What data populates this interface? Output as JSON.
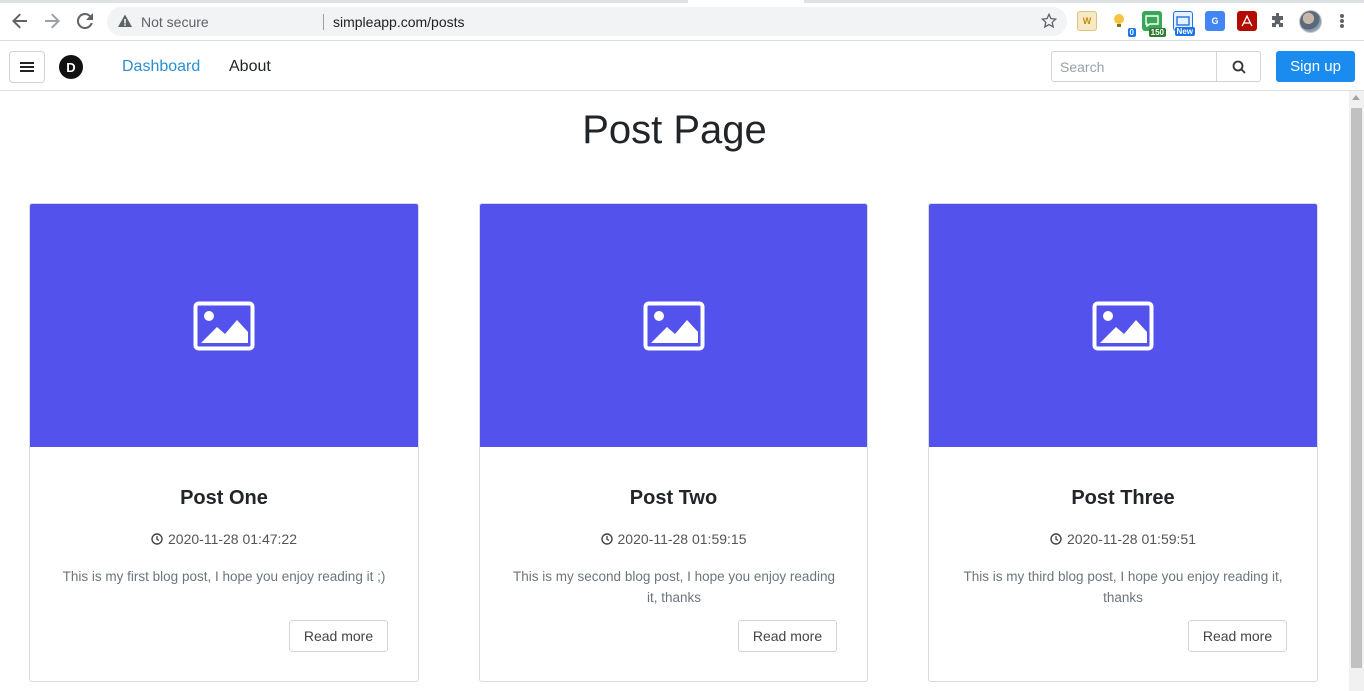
{
  "browser": {
    "security_label": "Not secure",
    "url": "simpleapp.com/posts",
    "extensions": [
      {
        "name": "w-extension",
        "label": "W",
        "color": "#e8a23a"
      },
      {
        "name": "bulb-extension",
        "label": "",
        "badge": "0",
        "color": "#f5c542"
      },
      {
        "name": "counter-extension",
        "label": "",
        "badge": "150",
        "color": "#3aa757"
      },
      {
        "name": "news-extension",
        "label": "",
        "badge": "New",
        "color": "#1a73e8"
      },
      {
        "name": "translate-extension",
        "label": "G",
        "color": "#4285f4"
      },
      {
        "name": "pdf-extension",
        "label": "",
        "color": "#b30b00"
      }
    ]
  },
  "navbar": {
    "brand_letter": "D",
    "links": {
      "dashboard": "Dashboard",
      "about": "About"
    },
    "search": {
      "placeholder": "Search"
    },
    "signup_label": "Sign up"
  },
  "page": {
    "title": "Post Page"
  },
  "posts": [
    {
      "title": "Post One",
      "date": "2020-11-28 01:47:22",
      "excerpt": "This is my first blog post, I hope you enjoy reading it ;)",
      "button": "Read more"
    },
    {
      "title": "Post Two",
      "date": "2020-11-28 01:59:15",
      "excerpt": "This is my second blog post, I hope you enjoy reading it, thanks",
      "button": "Read more"
    },
    {
      "title": "Post Three",
      "date": "2020-11-28 01:59:51",
      "excerpt": "This is my third blog post, I hope you enjoy reading it, thanks",
      "button": "Read more"
    }
  ],
  "colors": {
    "thumbnail": "#5352ed",
    "primary": "#1a8cf0",
    "active_link": "#2a8fd0"
  }
}
